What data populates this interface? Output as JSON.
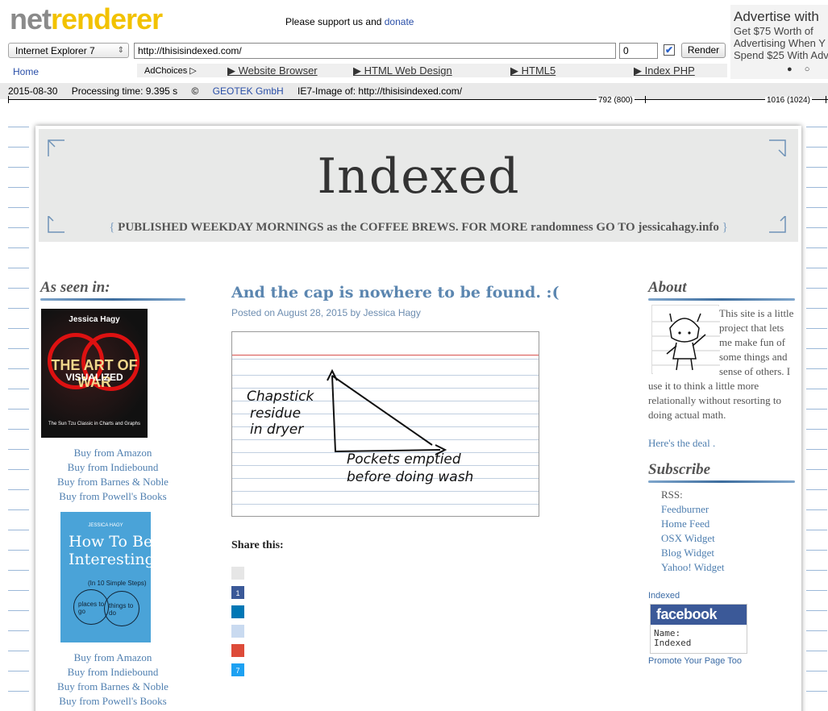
{
  "topbar": {
    "logo_part1": "net",
    "logo_part2": "renderer",
    "support_text": "Please support us and ",
    "donate_link": "donate",
    "ad": {
      "title": "Advertise with",
      "line1": "Get $75 Worth of",
      "line2": "Advertising When Y",
      "line3": "Spend $25 With Adv",
      "dots": "● ○"
    }
  },
  "controls": {
    "browser_select": "Internet Explorer 7",
    "url": "http://thisisindexed.com/",
    "delay": "0",
    "checkbox_mark": "✔",
    "render_button": "Render"
  },
  "nav": {
    "home": "Home",
    "adchoices": "AdChoices ▷",
    "links": [
      "▶ Website Browser",
      "▶ HTML Web Design",
      "▶ HTML5",
      "▶ Index PHP"
    ]
  },
  "status": {
    "date": "2015-08-30",
    "processing": "Processing time: 9.395 s",
    "copyright": "© ",
    "company": "GEOTEK GmbH",
    "image_of": "IE7-Image of: http://thisisindexed.com/",
    "mark1": "792 (800)",
    "mark2": "1016 (1024)"
  },
  "site": {
    "title": "Indexed",
    "tagline_open": "{ ",
    "tagline": "PUBLISHED WEEKDAY MORNINGS as the COFFEE BREWS. FOR MORE randomness GO TO jessicahagy.info",
    "tagline_close": " }"
  },
  "left": {
    "heading": "As seen in:",
    "book1": {
      "author": "Jessica Hagy",
      "title": "THE ART OF WAR",
      "subtitle": "VISUALIZED",
      "tagline": "The Sun Tzu Classic in Charts and Graphs"
    },
    "book2": {
      "author": "JESSICA HAGY",
      "title": "How To Be Interesting",
      "subtitle": "(In 10 Simple Steps)",
      "circle1": "places to go",
      "circle2": "things to do"
    },
    "links1": [
      "Buy from Amazon",
      "Buy from Indiebound",
      "Buy from Barnes & Noble",
      "Buy from Powell's Books"
    ],
    "links2": [
      "Buy from Amazon",
      "Buy from Indiebound",
      "Buy from Barnes & Noble",
      "Buy from Powell's Books"
    ]
  },
  "post": {
    "title": "And the cap is nowhere to be found. :(",
    "posted_on": "Posted on ",
    "date": "August 28, 2015",
    "by": " by ",
    "author": "Jessica Hagy",
    "card": {
      "y_label_1": "Chapstick",
      "y_label_2": "residue",
      "y_label_3": "in dryer",
      "x_label_1": "Pockets emptied",
      "x_label_2": "before doing wash"
    },
    "share_heading": "Share this:",
    "share_counts": {
      "facebook": "1",
      "twitter": "7"
    },
    "share_colors": [
      "#e6e6e6",
      "#3b5998",
      "#0077b5",
      "#c9daf0",
      "#dd4b39",
      "#1da1f2"
    ]
  },
  "right": {
    "about_heading": "About",
    "about_text": "This site is a little project that lets me make fun of some things and sense of others. I use it to think a little more relationally without resorting to doing actual math.",
    "deal_link": "Here's the deal .",
    "subscribe_heading": "Subscribe",
    "rss_label": "RSS:",
    "subscribe_links": [
      "Feedburner",
      "Home Feed",
      "OSX Widget",
      "Blog Widget",
      "Yahoo! Widget"
    ],
    "fb_label": "Indexed",
    "fb_logo": "facebook",
    "fb_name_label": "Name:",
    "fb_name": "Indexed",
    "fb_promo": "Promote Your Page Too"
  }
}
